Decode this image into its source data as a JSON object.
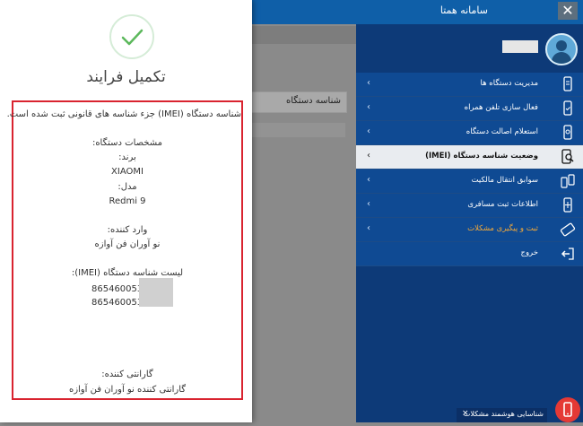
{
  "window": {
    "title": "سامانه همتا",
    "close_glyph": "✕"
  },
  "background": {
    "card_label": "شناسه دستگاه"
  },
  "profile": {
    "user_masked": ""
  },
  "sidebar": {
    "items": [
      {
        "label": "مدیریت دستگاه ها",
        "icon": "phone-list-icon",
        "state": "normal"
      },
      {
        "label": "فعال سازی تلفن همراه",
        "icon": "phone-activate-icon",
        "state": "normal"
      },
      {
        "label": "استعلام اصالت دستگاه",
        "icon": "phone-inquiry-icon",
        "state": "normal"
      },
      {
        "label": "وضعیت شناسه دستگاه (IMEI)",
        "icon": "phone-search-icon",
        "state": "active"
      },
      {
        "label": "سوابق انتقال مالکیت",
        "icon": "transfer-icon",
        "state": "normal"
      },
      {
        "label": "اطلاعات ثبت مسافری",
        "icon": "traveler-icon",
        "state": "normal"
      },
      {
        "label": "ثبت و پیگیری مشکلات",
        "icon": "ticket-icon",
        "state": "highlight"
      },
      {
        "label": "خروج",
        "icon": "logout-icon",
        "state": "normal"
      }
    ],
    "chevron": "‹"
  },
  "modal": {
    "title": "تکمیل فرایند",
    "message": "شناسه دستگاه (IMEI) جزء شناسه های قانونی ثبت شده است.",
    "specs_heading": "مشخصات دستگاه:",
    "brand_label": "برند:",
    "brand_value": "XIAOMI",
    "model_label": "مدل:",
    "model_value": "Redmi 9",
    "importer_label": "وارد کننده:",
    "importer_value": "نو آوران فن آوازه",
    "imei_list_label": "لیست شناسه دستگاه (IMEI):",
    "imei_list": [
      "865460053",
      "865460053"
    ],
    "guarantor_label": "گارانتی کننده:",
    "guarantor_value": "گارانتی کننده نو آوران فن آوازه"
  },
  "chat": {
    "label": "شناسایی هوشمند مشکلات",
    "close_glyph": "×"
  },
  "colors": {
    "primary": "#0f4a93",
    "dark": "#0d3a78",
    "accent_orange": "#f0a83a",
    "alert_red": "#d9232f",
    "success_green": "#5cb85c"
  }
}
